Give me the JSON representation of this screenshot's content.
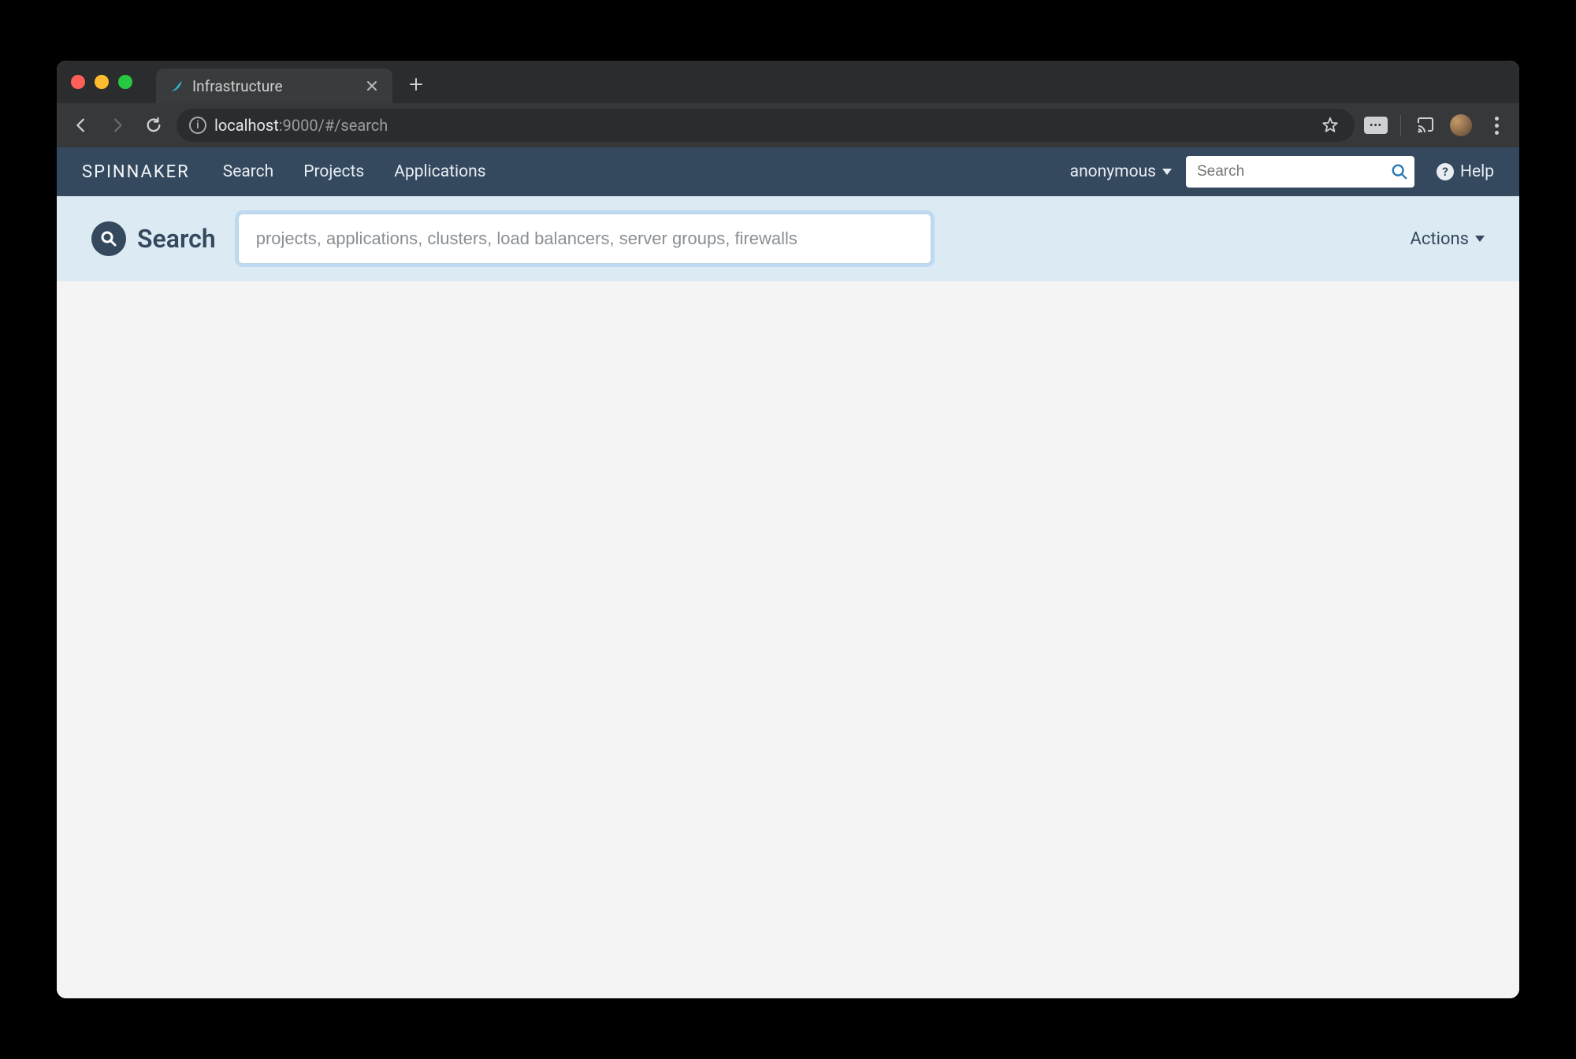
{
  "chrome": {
    "tab_title": "Infrastructure",
    "url_host": "localhost",
    "url_rest": ":9000/#/search",
    "ext_badge": "•••"
  },
  "header": {
    "brand": "SPINNAKER",
    "nav": [
      "Search",
      "Projects",
      "Applications"
    ],
    "user": "anonymous",
    "search_placeholder": "Search",
    "help_label": "Help"
  },
  "page": {
    "title": "Search",
    "search_placeholder": "projects, applications, clusters, load balancers, server groups, firewalls",
    "actions_label": "Actions"
  }
}
